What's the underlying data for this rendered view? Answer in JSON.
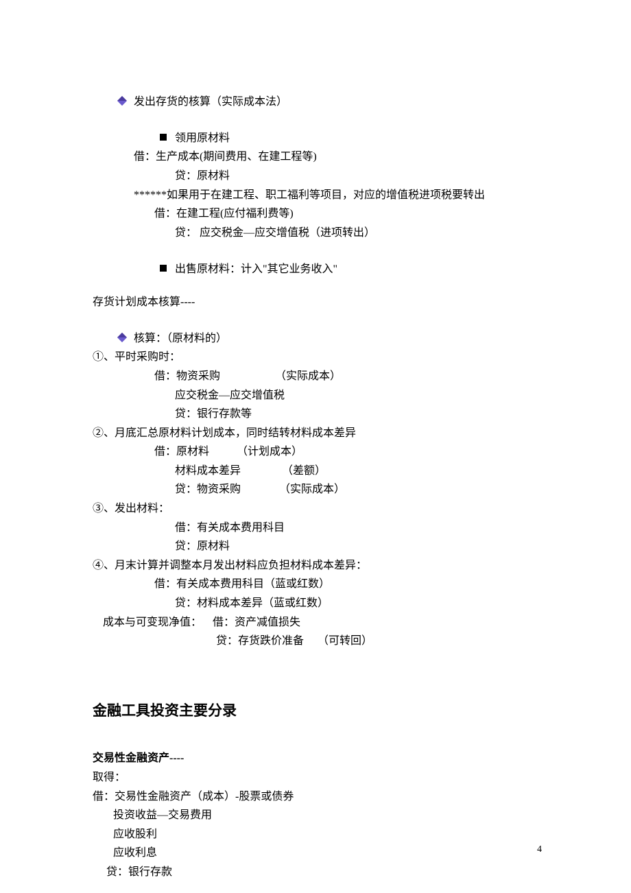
{
  "section1": {
    "bullet1": "发出存货的核算（实际成本法）",
    "sub1": "领用原材料",
    "line1": "借：生产成本(期间费用、在建工程等)",
    "line2": "贷：原材料",
    "line3": "******如果用于在建工程、职工福利等项目，对应的增值税进项税要转出",
    "line4": "借：在建工程(应付福利费等)",
    "line5": "贷： 应交税金—应交增值税（进项转出）",
    "sub2": "出售原材料：计入\"其它业务收入\""
  },
  "section2": {
    "title": "存货计划成本核算----",
    "bullet1": "核算：（原材料的）",
    "item1": "①、平时采购时：",
    "line1": "借：物资采购                    （实际成本）",
    "line2": "应交税金—应交增值税",
    "line3": "贷：银行存款等",
    "item2": "②、月底汇总原材料计划成本，同时结转材料成本差异",
    "line4": "借：原材料          （计划成本）",
    "line5": "材料成本差异               （差额）",
    "line6": "贷：物资采购              （实际成本）",
    "item3": "③、发出材料：",
    "line7": "借：有关成本费用科目",
    "line8": "贷：原材料",
    "item4": "④、月末计算并调整本月发出材料应负担材料成本差异：",
    "line9": "借：有关成本费用科目（蓝或红数）",
    "line10": "贷：材料成本差异（蓝或红数）",
    "line11": "成本与可变现净值：    借：资产减值损失",
    "line12": "贷：存货跌价准备     （可转回）"
  },
  "section3": {
    "heading": "金融工具投资主要分录",
    "subheading": "交易性金融资产----",
    "line1": "取得：",
    "line2": "借：交易性金融资产（成本）-股票或债券",
    "line3": "投资收益—交易费用",
    "line4": "应收股利",
    "line5": "应收利息",
    "line6": "贷：银行存款"
  },
  "pageNumber": "4"
}
